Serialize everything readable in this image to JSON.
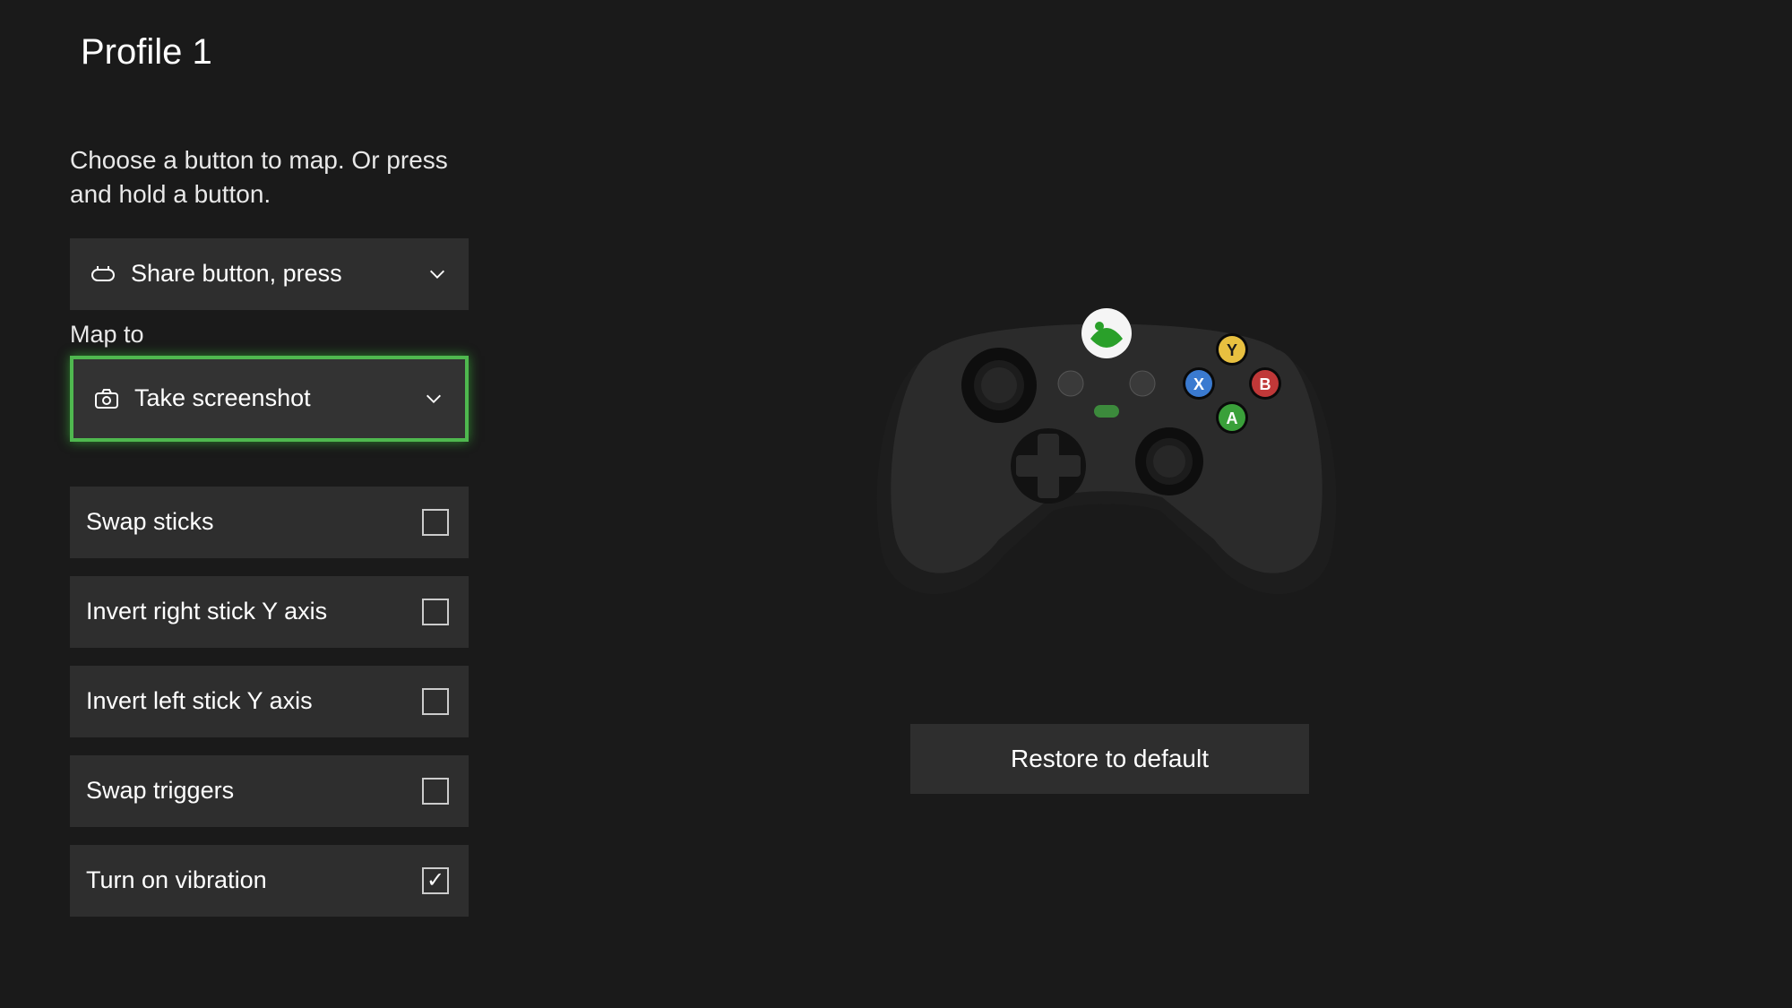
{
  "title": "Profile 1",
  "instruction": "Choose a button to map. Or press and hold a button.",
  "button_select": {
    "label": "Share button, press"
  },
  "map_to": {
    "label": "Map to",
    "value": "Take screenshot"
  },
  "checkboxes": [
    {
      "label": "Swap sticks",
      "checked": false
    },
    {
      "label": "Invert right stick Y axis",
      "checked": false
    },
    {
      "label": "Invert left stick Y axis",
      "checked": false
    },
    {
      "label": "Swap triggers",
      "checked": false
    },
    {
      "label": "Turn on vibration",
      "checked": true
    }
  ],
  "restore_button": "Restore to default"
}
